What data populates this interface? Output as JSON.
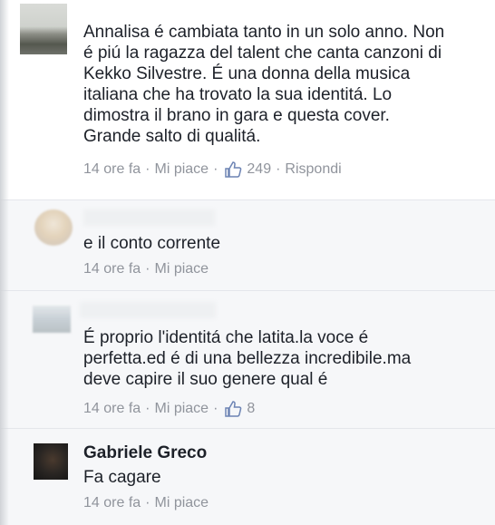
{
  "comments": [
    {
      "text_lines": [
        "Annalisa é cambiata tanto in un solo anno. Non",
        "é piú la ragazza del talent che canta canzoni di",
        "Kekko Silvestre. É una donna della musica",
        "italiana che ha trovato la sua identitá. Lo",
        "dimostra il brano in gara e questa cover.",
        "Grande salto di qualitá."
      ],
      "time": "14 ore fa",
      "like_label": "Mi piace",
      "like_count": "249",
      "reply_label": "Rispondi",
      "dot": "·"
    }
  ],
  "replies": [
    {
      "author": "",
      "text": "e il conto corrente",
      "time": "14 ore fa",
      "like_label": "Mi piace",
      "dot": "·"
    },
    {
      "author": "",
      "text_lines": [
        "É proprio l'identitá che latita.la voce é",
        "perfetta.ed é di una bellezza incredibile.ma",
        "deve capire il suo genere qual é"
      ],
      "time": "14 ore fa",
      "like_label": "Mi piace",
      "like_count": "8",
      "dot": "·"
    },
    {
      "author": "Gabriele Greco",
      "text": "Fa cagare",
      "time": "14 ore fa",
      "like_label": "Mi piace",
      "dot": "·"
    }
  ],
  "colors": {
    "text": "#1d2129",
    "meta": "#90949c",
    "reply_bg": "#f6f7f9"
  },
  "icons": {
    "thumb": "thumbs-up-icon"
  }
}
